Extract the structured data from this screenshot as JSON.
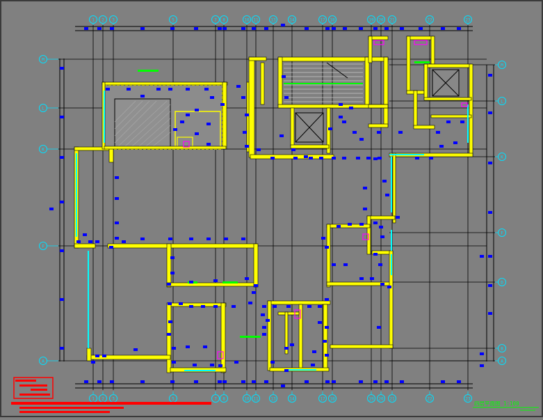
{
  "drawing": {
    "kind": "CAD floor plan",
    "colors": {
      "background": "#808080",
      "frame": "#4a4a4a",
      "wall": "#ffff00",
      "wall_fill": "#1a1a1a",
      "window": "#00ffff",
      "dim_line": "#000000",
      "axis_bubble": "#00e0ff",
      "tag": "#0000ff",
      "green": "#00ff00",
      "magenta": "#ff00ff",
      "red": "#ff0000"
    },
    "top_axis_labels": [
      "1",
      "2",
      "3",
      "5",
      "7",
      "8",
      "10",
      "11",
      "13",
      "14",
      "17",
      "18",
      "19",
      "20",
      "21",
      "22",
      "23"
    ],
    "bottom_axis_labels": [
      "1",
      "2",
      "3",
      "5",
      "7",
      "8",
      "10",
      "11",
      "13",
      "14",
      "17",
      "18",
      "19",
      "20",
      "21",
      "22",
      "23"
    ],
    "left_axis_labels": [
      "M",
      "L",
      "K",
      "F",
      "A"
    ],
    "right_axis_labels": [
      "M",
      "L",
      "K",
      "F",
      "D",
      "B",
      "A"
    ],
    "caption": "四层平面图 1:100"
  }
}
